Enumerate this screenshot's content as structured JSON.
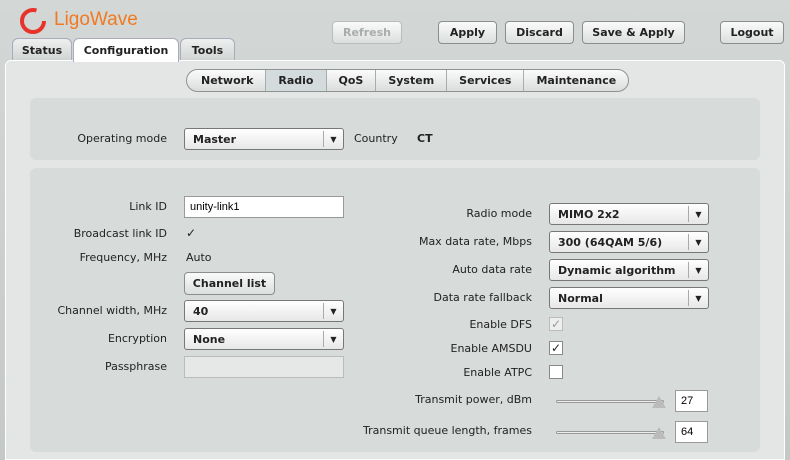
{
  "brand": {
    "name": "LigoWave",
    "logo_color": "#e8332a",
    "text_color": "#f07a22"
  },
  "tabs": [
    {
      "label": "Status"
    },
    {
      "label": "Configuration",
      "active": true
    },
    {
      "label": "Tools"
    }
  ],
  "toolbar": {
    "refresh": "Refresh",
    "apply": "Apply",
    "discard": "Discard",
    "save_apply": "Save & Apply",
    "logout": "Logout"
  },
  "subtabs": [
    {
      "label": "Network"
    },
    {
      "label": "Radio",
      "active": true
    },
    {
      "label": "QoS"
    },
    {
      "label": "System"
    },
    {
      "label": "Services"
    },
    {
      "label": "Maintenance"
    }
  ],
  "general": {
    "operating_mode_label": "Operating mode",
    "operating_mode": "Master",
    "country_label": "Country",
    "country": "CT"
  },
  "left": {
    "link_id_label": "Link ID",
    "link_id": "unity-link1",
    "broadcast_label": "Broadcast link ID",
    "broadcast": true,
    "frequency_label": "Frequency, MHz",
    "frequency": "Auto",
    "channel_list": "Channel list",
    "channel_width_label": "Channel width, MHz",
    "channel_width": "40",
    "encryption_label": "Encryption",
    "encryption": "None",
    "passphrase_label": "Passphrase",
    "passphrase": ""
  },
  "right": {
    "radio_mode_label": "Radio mode",
    "radio_mode": "MIMO 2x2",
    "max_rate_label": "Max data rate, Mbps",
    "max_rate": "300 (64QAM 5/6)",
    "auto_rate_label": "Auto data rate",
    "auto_rate": "Dynamic algorithm",
    "fallback_label": "Data rate fallback",
    "fallback": "Normal",
    "dfs_label": "Enable DFS",
    "dfs": true,
    "amsdu_label": "Enable AMSDU",
    "amsdu": true,
    "atpc_label": "Enable ATPC",
    "atpc": false,
    "tx_power_label": "Transmit power, dBm",
    "tx_power": "27",
    "tx_power_slider_pct": 100,
    "queue_label": "Transmit queue length, frames",
    "queue": "64",
    "queue_slider_pct": 100
  },
  "check_glyph": "✓",
  "arrow_glyph": "▼"
}
